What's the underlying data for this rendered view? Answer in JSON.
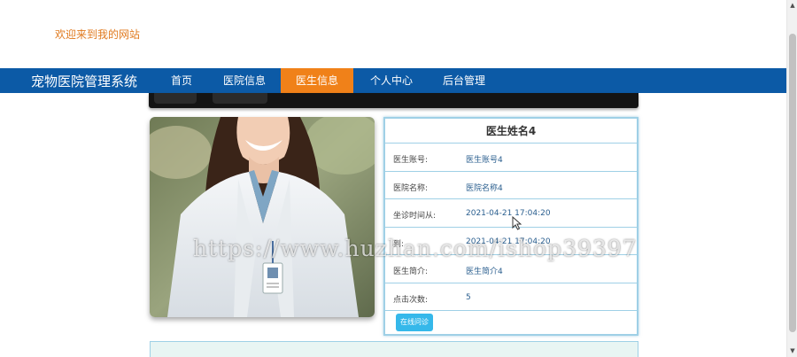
{
  "header": {
    "welcome": "欢迎来到我的网站"
  },
  "nav": {
    "brand": "宠物医院管理系统",
    "items": [
      {
        "label": "首页"
      },
      {
        "label": "医院信息"
      },
      {
        "label": "医生信息",
        "active": true
      },
      {
        "label": "个人中心"
      },
      {
        "label": "后台管理"
      }
    ]
  },
  "doctor": {
    "title": "医生姓名4",
    "fields": [
      {
        "label": "医生账号:",
        "value": "医生账号4"
      },
      {
        "label": "医院名称:",
        "value": "医院名称4"
      },
      {
        "label": "坐诊时间从:",
        "value": "2021-04-21 17:04:20"
      },
      {
        "label": "到:",
        "value": "2021-04-21 17:04:20"
      },
      {
        "label": "医生简介:",
        "value": "医生简介4"
      },
      {
        "label": "点击次数:",
        "value": "5"
      }
    ],
    "consult_button": "在线问诊"
  },
  "watermark": "https://www.huzhan.com/ishop39397",
  "colors": {
    "nav_bg": "#0c5aa6",
    "nav_active": "#f08119",
    "welcome": "#e07a1f",
    "accent_button": "#35b8ea",
    "panel_border": "#9fd0e6"
  }
}
